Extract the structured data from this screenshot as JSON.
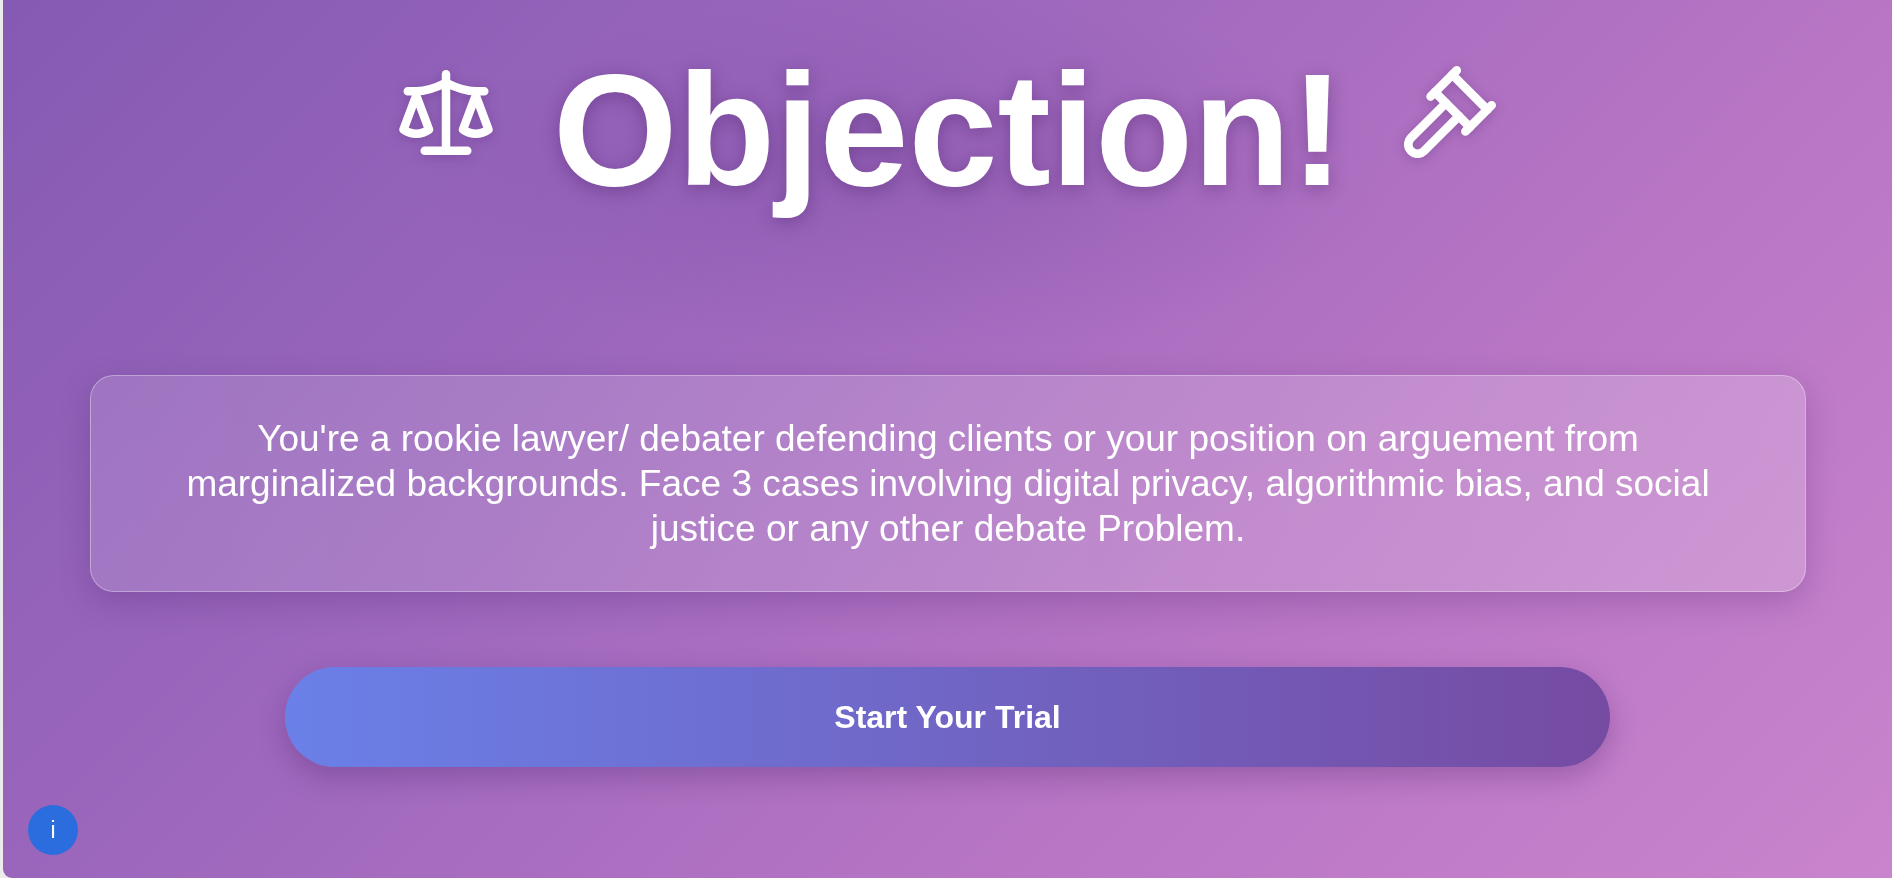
{
  "title": {
    "text": "Objection!"
  },
  "intro": {
    "text": "You're a rookie lawyer/ debater defending clients or your position on arguement from marginalized backgrounds. Face 3 cases involving digital privacy, algorithmic bias, and social justice or any other debate Problem."
  },
  "start_button": {
    "label": "Start Your Trial"
  },
  "info_button": {
    "label": "i"
  }
}
